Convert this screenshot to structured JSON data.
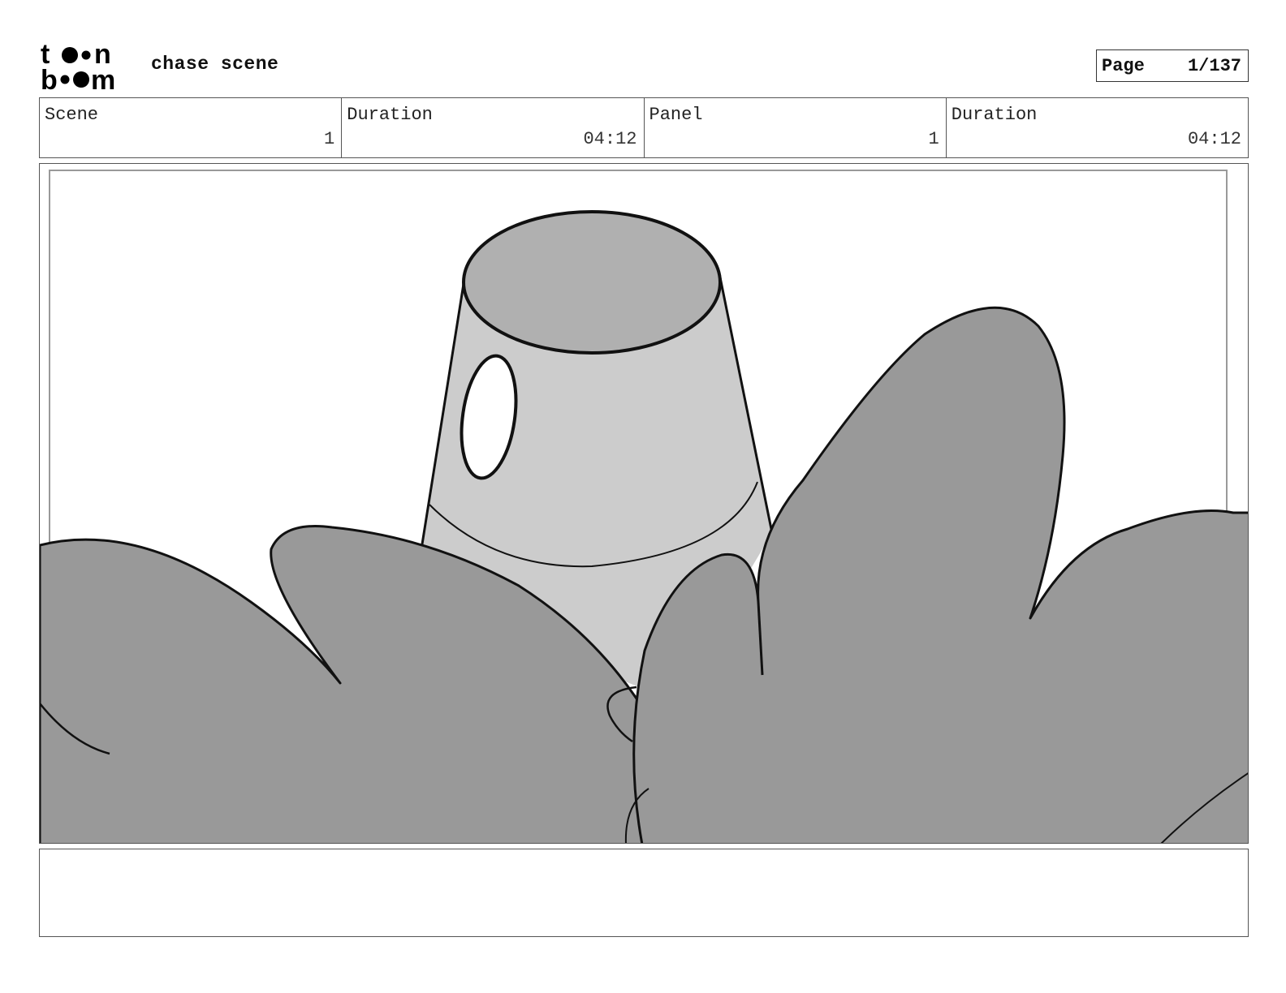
{
  "logo": {
    "line1": "toon",
    "line2": "boom"
  },
  "header": {
    "project_title": "chase scene"
  },
  "page": {
    "label": "Page",
    "value": "1/137"
  },
  "info": {
    "scene_label": "Scene",
    "scene_value": "1",
    "scene_duration_label": "Duration",
    "scene_duration_value": "04:12",
    "panel_label": "Panel",
    "panel_value": "1",
    "panel_duration_label": "Duration",
    "panel_duration_value": "04:12"
  },
  "panel": {
    "image_icon": "storyboard-drawing-icon"
  },
  "notes": {
    "text": ""
  },
  "colors": {
    "ink": "#111111",
    "cup_top": "#b0b0b0",
    "cup_body": "#cccccc",
    "leaves": "#999999",
    "border": "#555555"
  }
}
